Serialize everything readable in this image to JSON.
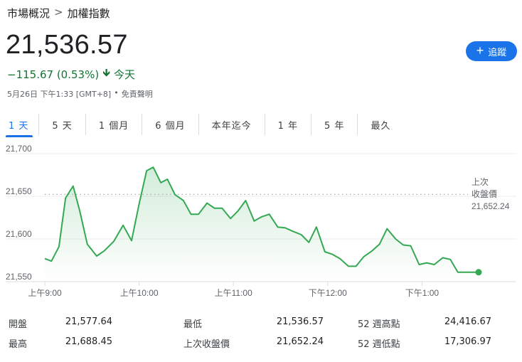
{
  "breadcrumb": {
    "parent": "市場概況",
    "separator": ">",
    "current": "加權指數"
  },
  "quote": {
    "price": "21,536.57",
    "change": "−115.67 (0.53%)",
    "direction_icon": "arrow-down-icon",
    "period": "今天",
    "timestamp": "5月26日 下午1:33 [GMT+8]",
    "bullet": "•",
    "disclaimer": "免責聲明"
  },
  "follow_button": {
    "label": "追蹤",
    "icon": "plus-icon"
  },
  "tabs": [
    {
      "label": "1 天",
      "active": true
    },
    {
      "label": "5 天"
    },
    {
      "label": "1 個月"
    },
    {
      "label": "6 個月"
    },
    {
      "label": "本年迄今"
    },
    {
      "label": "1 年"
    },
    {
      "label": "5 年"
    },
    {
      "label": "最久"
    }
  ],
  "colors": {
    "line": "#34a853",
    "fill_top": "#34a853",
    "change_text": "#137333",
    "accent": "#1a73e8"
  },
  "chart_data": {
    "type": "area",
    "x_ticks": [
      {
        "t": 9.0,
        "label": "上午9:00"
      },
      {
        "t": 10.0,
        "label": "上午10:00"
      },
      {
        "t": 11.0,
        "label": "上午11:00"
      },
      {
        "t": 12.0,
        "label": "下午12:00"
      },
      {
        "t": 13.0,
        "label": "下午1:00"
      }
    ],
    "y_ticks": [
      21550,
      21600,
      21650,
      21700
    ],
    "y_tick_labels": [
      "21,550",
      "21,600",
      "21,650",
      "21,700"
    ],
    "xlim": [
      9.0,
      14.0
    ],
    "ylim": [
      21550,
      21700
    ],
    "previous_close": {
      "value": 21652.24,
      "label_line1": "上次",
      "label_line2": "收盤價",
      "value_label": "21,652.24"
    },
    "x": [
      9.0,
      9.07,
      9.15,
      9.22,
      9.3,
      9.37,
      9.45,
      9.55,
      9.63,
      9.73,
      9.83,
      9.92,
      10.0,
      10.08,
      10.15,
      10.23,
      10.3,
      10.38,
      10.47,
      10.55,
      10.63,
      10.72,
      10.8,
      10.88,
      10.97,
      11.05,
      11.13,
      11.22,
      11.3,
      11.38,
      11.47,
      11.55,
      11.63,
      11.72,
      11.8,
      11.88,
      11.97,
      12.05,
      12.13,
      12.22,
      12.3,
      12.38,
      12.47,
      12.55,
      12.63,
      12.72,
      12.8,
      12.88,
      12.97,
      13.05,
      13.13,
      13.22,
      13.3,
      13.38,
      13.47,
      13.55,
      13.6
    ],
    "y": [
      21577,
      21574,
      21591,
      21648,
      21662,
      21633,
      21594,
      21580,
      21586,
      21597,
      21616,
      21598,
      21641,
      21680,
      21684,
      21666,
      21670,
      21652,
      21645,
      21629,
      21629,
      21642,
      21636,
      21636,
      21624,
      21633,
      21645,
      21621,
      21626,
      21629,
      21614,
      21613,
      21609,
      21605,
      21596,
      21614,
      21585,
      21582,
      21577,
      21568,
      21568,
      21579,
      21586,
      21594,
      21612,
      21600,
      21593,
      21592,
      21570,
      21572,
      21570,
      21578,
      21576,
      21561,
      21561,
      21561,
      21561
    ],
    "last_point_dot": true
  },
  "stats": {
    "left": [
      {
        "label": "開盤",
        "value": "21,577.64"
      },
      {
        "label": "最高",
        "value": "21,688.45"
      }
    ],
    "middle": [
      {
        "label": "最低",
        "value": "21,536.57"
      },
      {
        "label": "上次收盤價",
        "value": "21,652.24"
      }
    ],
    "right": [
      {
        "label": "52 週高點",
        "value": "24,416.67"
      },
      {
        "label": "52 週低點",
        "value": "17,306.97"
      }
    ]
  }
}
